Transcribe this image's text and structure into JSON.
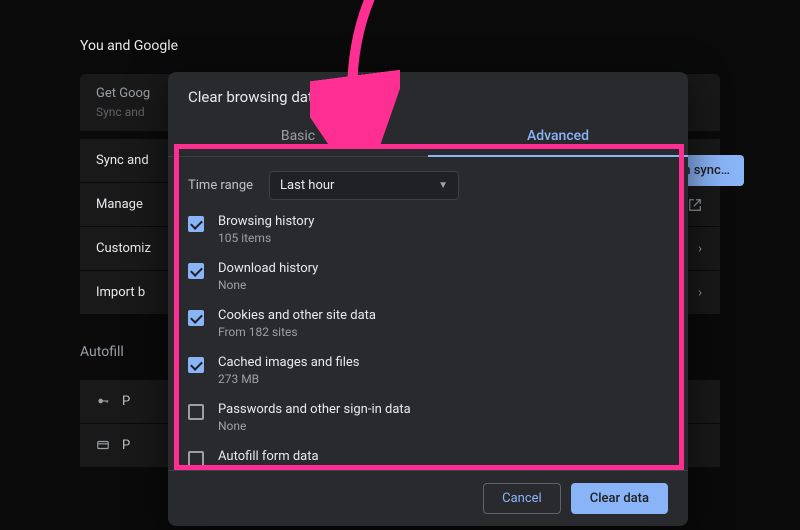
{
  "background": {
    "section1_title": "You and Google",
    "get_google": "Get Goog",
    "sync_and_sub": "Sync and",
    "sync_button": "on sync…",
    "rows": {
      "sync": "Sync and",
      "manage": "Manage",
      "customize": "Customiz",
      "import": "Import b"
    },
    "section2_title": "Autofill",
    "autofill_rows": {
      "p1_prefix": "P",
      "p2_prefix": "P"
    }
  },
  "dialog": {
    "title": "Clear browsing data",
    "tabs": {
      "basic": "Basic",
      "advanced": "Advanced"
    },
    "time_range_label": "Time range",
    "time_range_value": "Last hour",
    "items": [
      {
        "label": "Browsing history",
        "sub": "105 items",
        "checked": true
      },
      {
        "label": "Download history",
        "sub": "None",
        "checked": true
      },
      {
        "label": "Cookies and other site data",
        "sub": "From 182 sites",
        "checked": true
      },
      {
        "label": "Cached images and files",
        "sub": "273 MB",
        "checked": true
      },
      {
        "label": "Passwords and other sign-in data",
        "sub": "None",
        "checked": false
      },
      {
        "label": "Autofill form data",
        "sub": "",
        "checked": false
      }
    ],
    "cancel": "Cancel",
    "clear": "Clear data"
  },
  "annotation": {
    "arrow_color": "#ff2e92",
    "box_color": "#ff2e92"
  }
}
